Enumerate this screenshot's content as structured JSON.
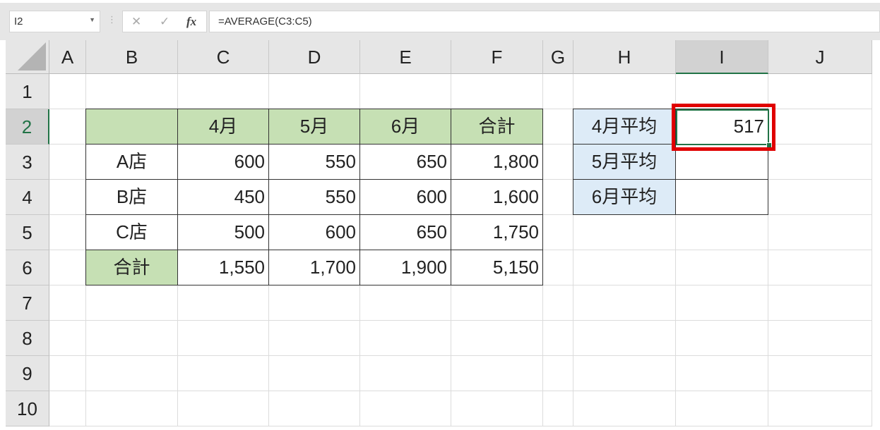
{
  "name_box": {
    "value": "I2",
    "dropdown_icon": "chevron-down-icon"
  },
  "formula_bar": {
    "cancel_icon": "✕",
    "enter_icon": "✓",
    "fx_label": "fx",
    "formula": "=AVERAGE(C3:C5)"
  },
  "columns": [
    "A",
    "B",
    "C",
    "D",
    "E",
    "F",
    "G",
    "H",
    "I",
    "J"
  ],
  "rows": [
    "1",
    "2",
    "3",
    "4",
    "5",
    "6",
    "7",
    "8",
    "9",
    "10"
  ],
  "selected_cell": "I2",
  "sales_table": {
    "header": [
      "",
      "4月",
      "5月",
      "6月",
      "合計"
    ],
    "rows": [
      {
        "label": "A店",
        "values": [
          "600",
          "550",
          "650",
          "1,800"
        ]
      },
      {
        "label": "B店",
        "values": [
          "450",
          "550",
          "600",
          "1,600"
        ]
      },
      {
        "label": "C店",
        "values": [
          "500",
          "600",
          "650",
          "1,750"
        ]
      },
      {
        "label": "合計",
        "values": [
          "1,550",
          "1,700",
          "1,900",
          "5,150"
        ]
      }
    ]
  },
  "average_table": [
    {
      "label": "4月平均",
      "value": "517"
    },
    {
      "label": "5月平均",
      "value": ""
    },
    {
      "label": "6月平均",
      "value": ""
    }
  ],
  "colors": {
    "header_green": "#c6e0b4",
    "label_blue": "#ddebf7",
    "selection": "#217346",
    "highlight": "#e00000"
  }
}
